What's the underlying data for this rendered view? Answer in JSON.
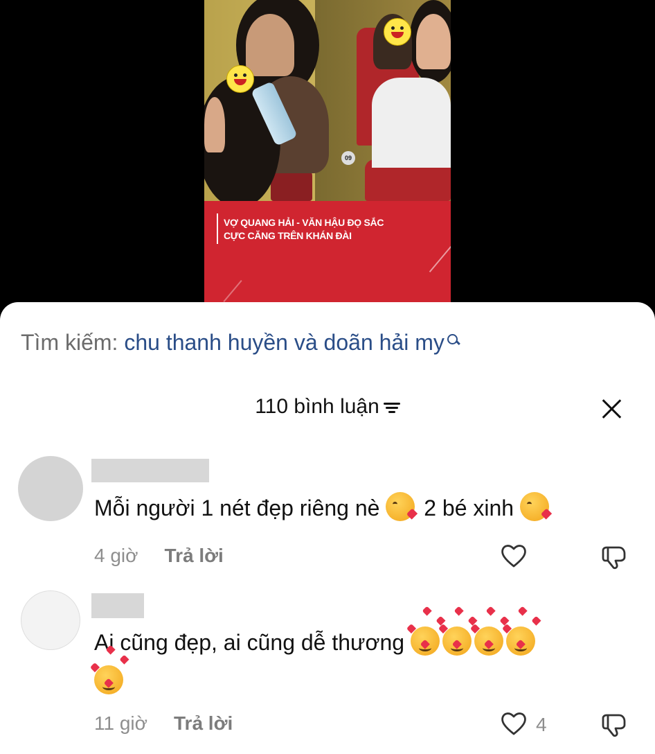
{
  "video": {
    "caption_line1": "VỢ QUANG HẢI - VĂN HẬU ĐỌ SẮC",
    "caption_line2": "CỰC CĂNG TRÊN KHÁN ĐÀI",
    "seat_number": "09",
    "colors": {
      "banner": "#d02530"
    }
  },
  "search": {
    "label": "Tìm kiếm:",
    "query": "chu thanh huyền và doãn hải my",
    "icon": "search-icon"
  },
  "header": {
    "title": "110 bình luận",
    "sort_icon": "sort-icon",
    "close_icon": "close-icon"
  },
  "comments": [
    {
      "text": "Mỗi người 1 nét đẹp riêng nè",
      "text_after_emoji": "2 bé xinh",
      "emoji": "face-blowing-kiss",
      "time": "4 giờ",
      "reply_label": "Trả lời",
      "likes": ""
    },
    {
      "text": "Ai cũng đẹp, ai cũng dễ thương",
      "emoji": "smiling-face-with-hearts",
      "emoji_count": 5,
      "time": "11 giờ",
      "reply_label": "Trả lời",
      "likes": "4"
    }
  ],
  "colors": {
    "query": "#2a4d87",
    "meta": "#8e8e8e"
  }
}
